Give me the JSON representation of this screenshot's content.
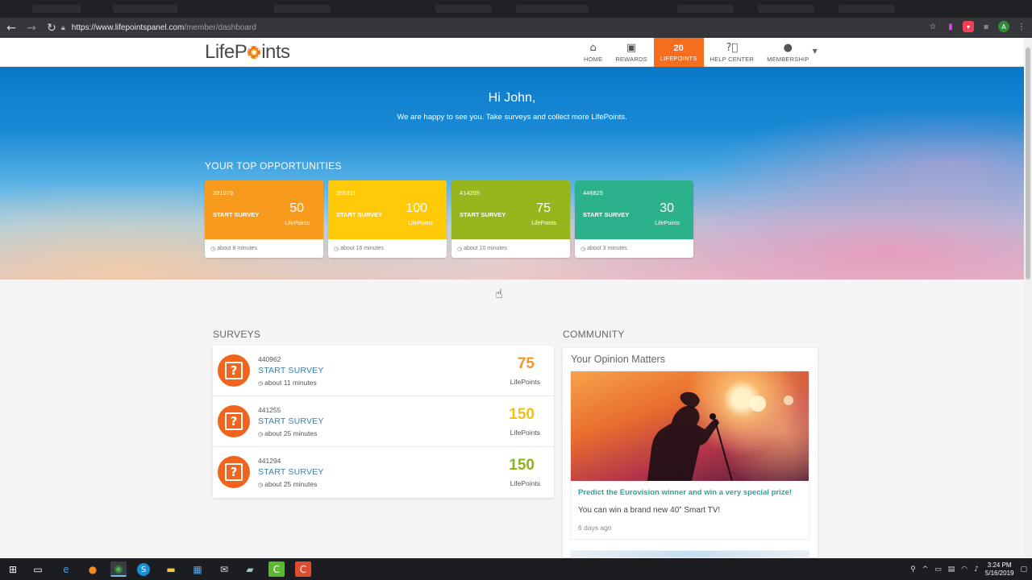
{
  "browser": {
    "url_host": "https://www.lifepointspanel.com",
    "url_path": "/member/dashboard"
  },
  "site": {
    "logo_left": "LifeP",
    "logo_right": "ints",
    "nav": [
      {
        "label": "HOME",
        "icon": "home-icon"
      },
      {
        "label": "REWARDS",
        "icon": "gift-icon"
      },
      {
        "label": "LIFEPOINTS",
        "count": "20"
      },
      {
        "label": "HELP CENTER",
        "icon": "help-icon"
      },
      {
        "label": "MEMBERSHIP",
        "icon": "user-icon"
      }
    ]
  },
  "hero": {
    "greeting": "Hi John,",
    "subtitle": "We are happy to see you. Take surveys and collect more LifePoints.",
    "top_title": "YOUR TOP OPPORTUNITIES",
    "cards": [
      {
        "id": "391079",
        "start": "START SURVEY",
        "points": "50",
        "points_label": "LifePoints",
        "duration": "about 8 minutes",
        "color": "#f89a1c"
      },
      {
        "id": "355311",
        "start": "START SURVEY",
        "points": "100",
        "points_label": "LifePoints",
        "duration": "about 16 minutes",
        "color": "#ffc907"
      },
      {
        "id": "414255",
        "start": "START SURVEY",
        "points": "75",
        "points_label": "LifePoints",
        "duration": "about 10 minutes",
        "color": "#97b51d"
      },
      {
        "id": "446825",
        "start": "START SURVEY",
        "points": "30",
        "points_label": "LifePoints",
        "duration": "about 3 minutes",
        "color": "#2bb28c"
      }
    ]
  },
  "surveys": {
    "title": "SURVEYS",
    "items": [
      {
        "id": "440962",
        "start": "START SURVEY",
        "duration": "about 11 minutes",
        "points": "75",
        "points_label": "LifePoints",
        "color": "#f7941d"
      },
      {
        "id": "441255",
        "start": "START SURVEY",
        "duration": "about 25 minutes",
        "points": "150",
        "points_label": "LifePoints",
        "color": "#f5c10a"
      },
      {
        "id": "441294",
        "start": "START SURVEY",
        "duration": "about 25 minutes",
        "points": "150",
        "points_label": "LifePoints",
        "color": "#8db41c"
      }
    ]
  },
  "community": {
    "title": "COMMUNITY",
    "card_title": "Your Opinion Matters",
    "post_title": "Predict the Eurovision winner and win a very special prize!",
    "post_text": "You can win a brand new 40” Smart TV!",
    "post_ago": "6 days ago"
  },
  "taskbar": {
    "time": "3:24 PM",
    "date": "5/16/2019"
  }
}
